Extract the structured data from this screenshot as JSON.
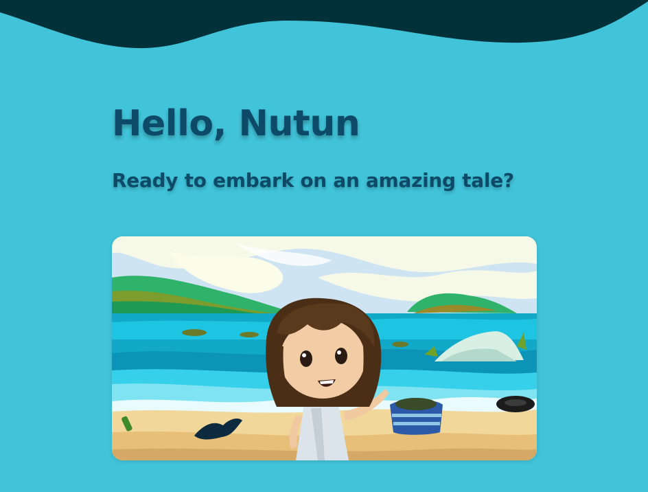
{
  "header": {
    "greeting": "Hello, Nutun",
    "subtitle": "Ready to embark on an amazing tale?"
  },
  "story_card": {
    "scene": "beach-scene-illustration"
  },
  "colors": {
    "background": "#41c3d9",
    "wave": "#02313a",
    "heading_text": "#0d4a68"
  }
}
